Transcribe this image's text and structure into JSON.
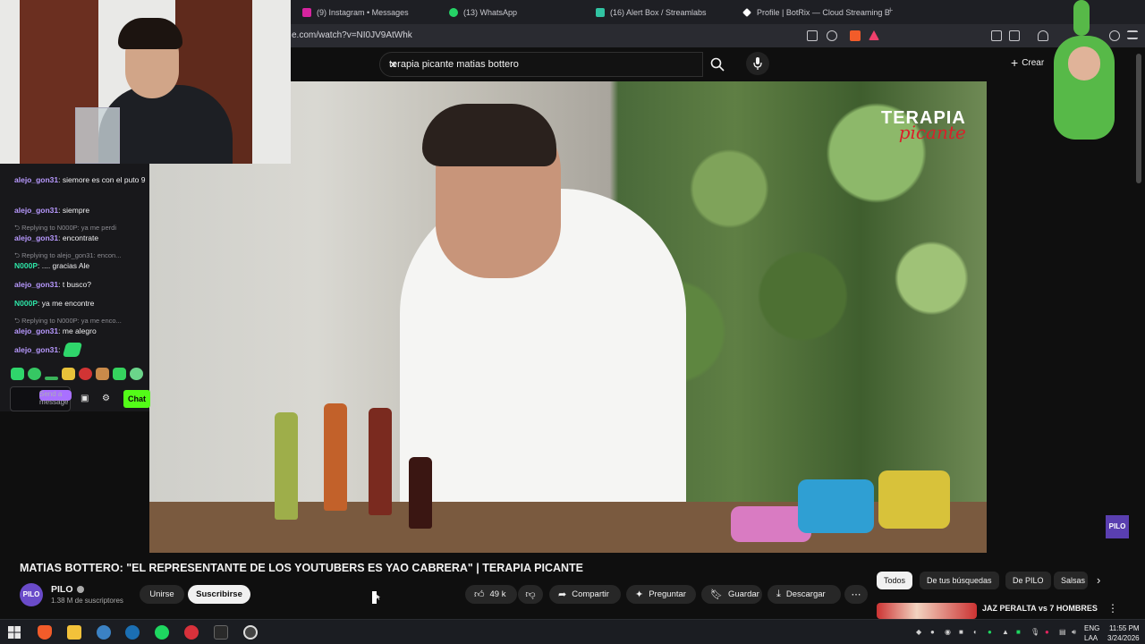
{
  "browser": {
    "tabs": [
      {
        "label": "(9) Instagram • Messages",
        "color": "#d6249f"
      },
      {
        "label": "(13) WhatsApp",
        "color": "#25d366"
      },
      {
        "label": "(16) Alert Box / Streamlabs",
        "color": "#31c3a2"
      },
      {
        "label": "Profile | BotRix — Cloud Streaming B",
        "color": "#ffffff"
      }
    ],
    "url": "e.com/watch?v=NI0JV9AtWhk"
  },
  "youtube": {
    "search_query": "terapia picante matias bottero",
    "create_label": "Crear",
    "video_title": "MATIAS BOTTERO: \"EL REPRESENTANTE DE LOS YOUTUBERS ES YAO CABRERA\" | TERAPIA PICANTE",
    "channel": {
      "name": "PILO",
      "subscribers": "1.38 M de suscriptores",
      "avatar_text": "PILO"
    },
    "join_label": "Unirse",
    "subscribe_label": "Suscribirse",
    "likes": "49 k",
    "share_label": "Compartir",
    "ask_label": "Preguntar",
    "save_label": "Guardar",
    "download_label": "Descargar",
    "chips": [
      "Todos",
      "De tus búsquedas",
      "De PILO",
      "Salsas"
    ],
    "suggestion_title": "JAZ PERALTA vs 7 HOMBRES",
    "watermark": {
      "line1": "TERAPIA",
      "line2": "picante"
    },
    "corner_badge": "PILO"
  },
  "chat": {
    "messages": [
      {
        "type": "msg",
        "user": "alejo_gon31",
        "text": "siemore es con el puto 9",
        "usercolor": "u1"
      },
      {
        "type": "msg",
        "user": "alejo_gon31",
        "text": "siempre",
        "usercolor": "u1"
      },
      {
        "type": "reply",
        "text": "Replying to N000P: ya me perdi"
      },
      {
        "type": "msg",
        "user": "alejo_gon31",
        "text": "encontrate",
        "usercolor": "u1"
      },
      {
        "type": "reply",
        "text": "Replying to alejo_gon31: encon..."
      },
      {
        "type": "msg",
        "user": "N000P",
        "text": ".... gracias Ale",
        "usercolor": "u2"
      },
      {
        "type": "msg",
        "user": "alejo_gon31",
        "text": "t busco?",
        "usercolor": "u1"
      },
      {
        "type": "msg",
        "user": "N000P",
        "text": "ya me encontre",
        "usercolor": "u2"
      },
      {
        "type": "reply",
        "text": "Replying to N000P: ya me enco..."
      },
      {
        "type": "msg",
        "user": "alejo_gon31",
        "text": "me alegro",
        "usercolor": "u1"
      },
      {
        "type": "msg",
        "user": "alejo_gon31",
        "text": "",
        "usercolor": "u1"
      }
    ],
    "input_placeholder": "Send a message",
    "chat_button": "Chat"
  },
  "taskbar": {
    "lang_line1": "ENG",
    "lang_line2": "LAA",
    "time": "11:55 PM",
    "date": "3/24/2026"
  }
}
